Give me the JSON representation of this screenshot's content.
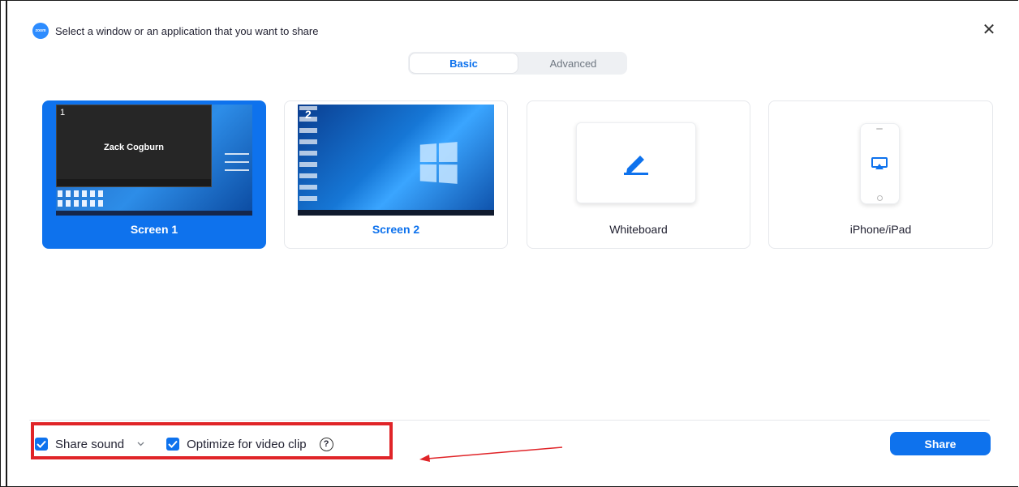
{
  "window": {
    "title": "Select a window or an application that you want to share",
    "app_icon_text": "zoom",
    "close_symbol": "✕"
  },
  "tabs": [
    {
      "label": "Basic",
      "active": true
    },
    {
      "label": "Advanced",
      "active": false
    }
  ],
  "cards": [
    {
      "label": "Screen 1",
      "selected": true,
      "thumb_number": "1",
      "thumb_text": "Zack Cogburn"
    },
    {
      "label": "Screen 2",
      "selected": false,
      "thumb_number": "2"
    },
    {
      "label": "Whiteboard",
      "selected": false,
      "icon": "pen-icon"
    },
    {
      "label": "iPhone/iPad",
      "selected": false,
      "icon": "airplay-icon"
    }
  ],
  "options": {
    "share_sound": {
      "label": "Share sound",
      "checked": true
    },
    "optimize_video": {
      "label": "Optimize for video clip",
      "checked": true
    },
    "help_symbol": "?"
  },
  "share_button": {
    "label": "Share"
  },
  "colors": {
    "accent": "#0e72ed",
    "annotation": "#e02428"
  }
}
